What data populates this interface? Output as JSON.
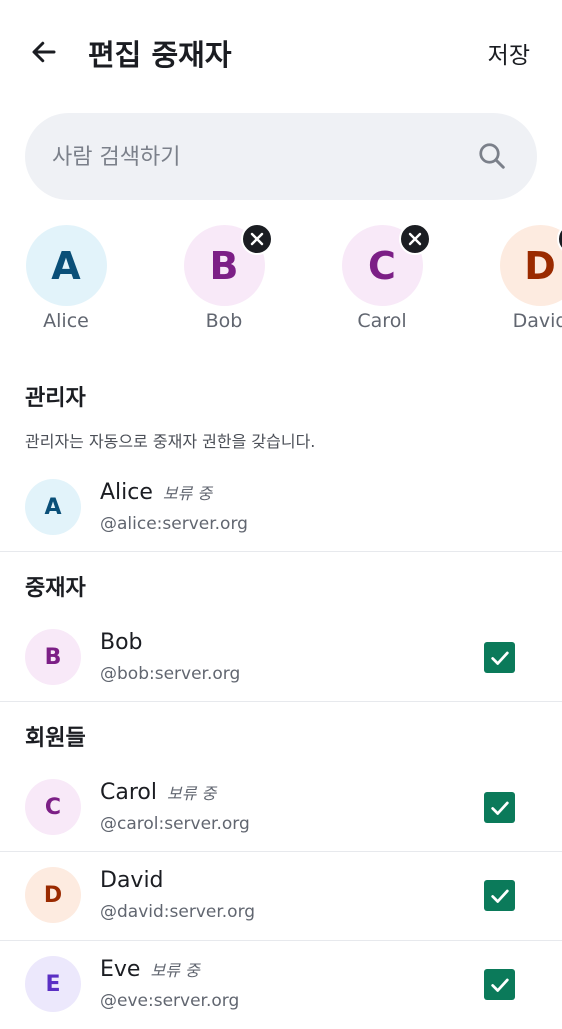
{
  "header": {
    "title": "편집 중재자",
    "save_label": "저장"
  },
  "search": {
    "placeholder": "사람 검색하기"
  },
  "selected_chips": [
    {
      "initial": "A",
      "name": "Alice",
      "bg": "#e2f3fa",
      "fg": "#0a4f78",
      "removable": false
    },
    {
      "initial": "B",
      "name": "Bob",
      "bg": "#f8e9f8",
      "fg": "#7c1f86",
      "removable": true
    },
    {
      "initial": "C",
      "name": "Carol",
      "bg": "#f8e9f8",
      "fg": "#7c1f86",
      "removable": true
    },
    {
      "initial": "D",
      "name": "David",
      "bg": "#fdebe0",
      "fg": "#9a2a00",
      "removable": true
    }
  ],
  "sections": {
    "admins": {
      "title": "관리자",
      "description": "관리자는 자동으로 중재자 권한을 갖습니다."
    },
    "moderators": {
      "title": "중재자"
    },
    "members": {
      "title": "회원들"
    }
  },
  "pending_label": "보류 중",
  "users": [
    {
      "initial": "A",
      "name": "Alice",
      "id": "@alice:server.org",
      "pending": true,
      "checked": null,
      "bg": "#e2f3fa",
      "fg": "#0a4f78"
    },
    {
      "initial": "B",
      "name": "Bob",
      "id": "@bob:server.org",
      "pending": false,
      "checked": true,
      "bg": "#f8e9f8",
      "fg": "#7c1f86"
    },
    {
      "initial": "C",
      "name": "Carol",
      "id": "@carol:server.org",
      "pending": true,
      "checked": true,
      "bg": "#f8e9f8",
      "fg": "#7c1f86"
    },
    {
      "initial": "D",
      "name": "David",
      "id": "@david:server.org",
      "pending": false,
      "checked": true,
      "bg": "#fdebe0",
      "fg": "#9a2a00"
    },
    {
      "initial": "E",
      "name": "Eve",
      "id": "@eve:server.org",
      "pending": true,
      "checked": true,
      "bg": "#ece8fc",
      "fg": "#5a2fc4"
    }
  ],
  "colors": {
    "accent_check": "#0b7a5a",
    "search_bg": "#eff1f5"
  }
}
